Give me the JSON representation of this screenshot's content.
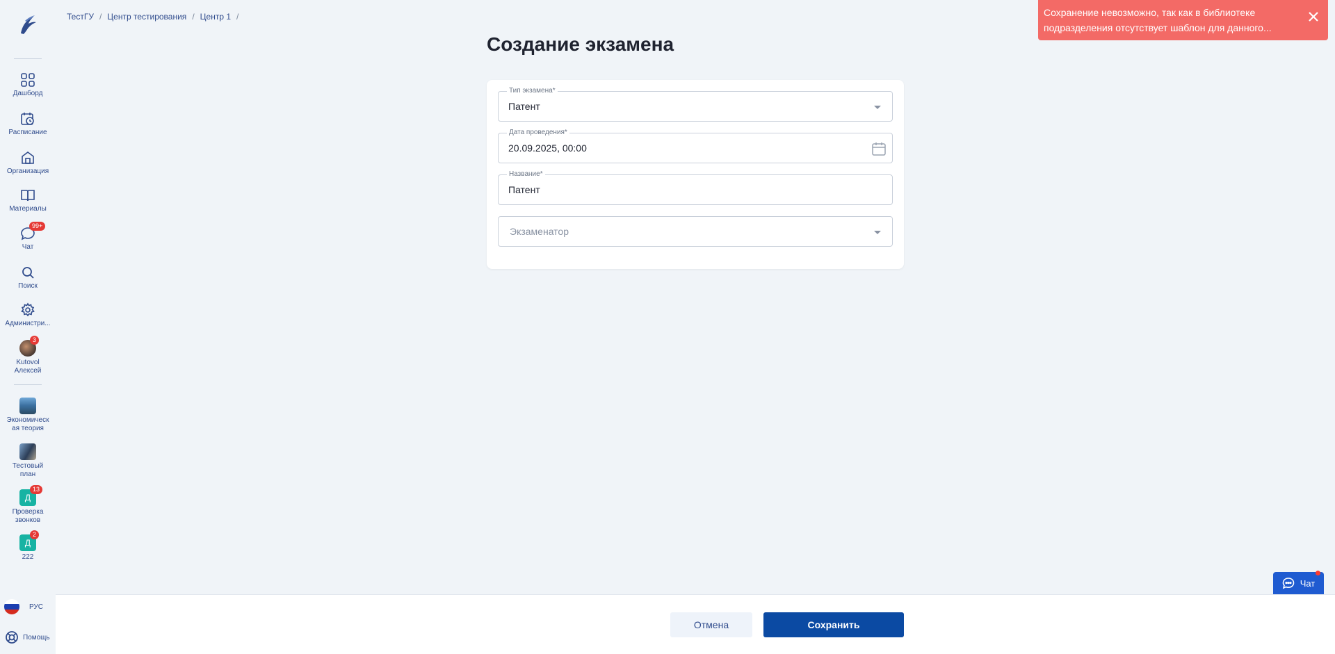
{
  "breadcrumb": {
    "items": [
      "ТестГУ",
      "Центр тестирования",
      "Центр 1"
    ],
    "separator": "/"
  },
  "page_title": "Создание экзамена",
  "form": {
    "exam_type": {
      "label": "Тип экзамена*",
      "value": "Патент"
    },
    "date": {
      "label": "Дата проведения*",
      "value": "20.09.2025, 00:00"
    },
    "name": {
      "label": "Название*",
      "value": "Патент"
    },
    "examiner": {
      "placeholder": "Экзаменатор"
    }
  },
  "sidebar": {
    "items": [
      {
        "label": "Дашборд",
        "icon": "grid-icon"
      },
      {
        "label": "Расписание",
        "icon": "calendar-clock-icon"
      },
      {
        "label": "Организация",
        "icon": "building-icon"
      },
      {
        "label": "Материалы",
        "icon": "book-icon"
      },
      {
        "label": "Чат",
        "icon": "chat-icon",
        "badge": "99+"
      },
      {
        "label": "Поиск",
        "icon": "search-icon"
      },
      {
        "label": "Администри...",
        "icon": "gear-icon"
      }
    ],
    "user": {
      "name_line1": "Kutovol",
      "name_line2": "Алексей",
      "badge": "3"
    },
    "courses": [
      {
        "line1": "Экономическ",
        "line2": "ая теория"
      },
      {
        "line1": "Тестовый",
        "line2": "план"
      },
      {
        "line1": "Проверка",
        "line2": "звонков",
        "letter": "Д",
        "badge": "13"
      },
      {
        "line1": "222",
        "line2": "",
        "letter": "Д",
        "badge": "2"
      }
    ],
    "language": "РУС",
    "help": "Помощь"
  },
  "footer": {
    "cancel_label": "Отмена",
    "save_label": "Сохранить"
  },
  "toast": {
    "message": "Сохранение невозможно, так как в библиотеке подразделения отсутствует шаблон для данного...",
    "color": "#f36a66"
  },
  "chat_widget": {
    "label": "Чат"
  },
  "colors": {
    "primary": "#0b4aa3",
    "background": "#f0f4f8",
    "link": "#2f4b8c",
    "badge": "#e53935",
    "teal": "#17b3a3"
  }
}
